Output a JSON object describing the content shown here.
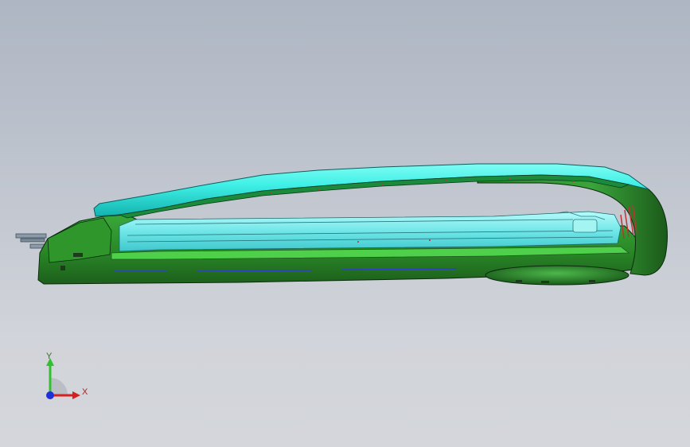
{
  "viewport": {
    "background_top": "#aeb6c3",
    "background_bottom": "#d4d6db"
  },
  "model": {
    "body_color": "#2e8f2a",
    "body_dark_color": "#17501a",
    "cover_color": "#3ff0e6",
    "cover_dark_color": "#10a8a6",
    "inner_color": "#6fe8ea",
    "edge_color": "#0a2a0c"
  },
  "triad": {
    "x_label": "X",
    "y_label": "Y",
    "x_color": "#d42020",
    "y_color": "#30c030",
    "z_color": "#2030d8"
  }
}
